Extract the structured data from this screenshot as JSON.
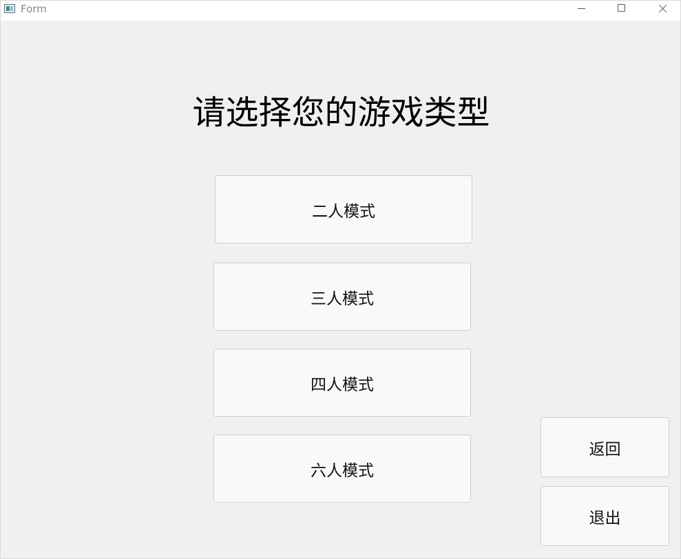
{
  "window": {
    "title": "Form",
    "icon": "app-window-icon",
    "controls": [
      "minimize-icon",
      "maximize-icon",
      "close-icon"
    ]
  },
  "heading": "请选择您的游戏类型",
  "modes": [
    {
      "label": "二人模式"
    },
    {
      "label": "三人模式"
    },
    {
      "label": "四人模式"
    },
    {
      "label": "六人模式"
    }
  ],
  "actions": {
    "back_label": "返回",
    "exit_label": "退出"
  }
}
